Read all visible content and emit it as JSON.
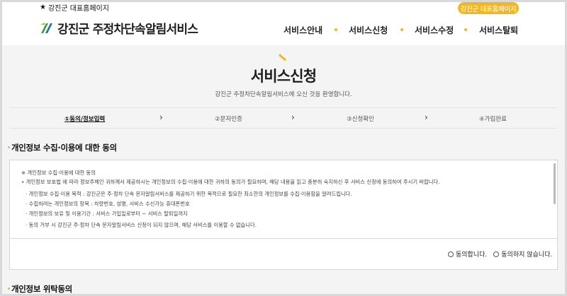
{
  "header": {
    "top_link": "강진군 대표홈페이지",
    "home_button": "강진군 대표홈페이지",
    "logo_text": "강진군 주정차단속알림서비스",
    "nav": [
      "서비스안내",
      "서비스신청",
      "서비스수정",
      "서비스탈퇴"
    ]
  },
  "page": {
    "title": "서비스신청",
    "subtitle": "강진군 주정차단속알림서비스에 오신 것을 환영합니다."
  },
  "steps": [
    "①동의/정보입력",
    "②문자인증",
    "③신청확인",
    "④가입완료"
  ],
  "sections": {
    "consent_title": "개인정보 수집·이용에 대한 동의",
    "entrust_title": "개인정보 위탁동의"
  },
  "terms": {
    "heading": "※ 개인정보 수집·이용에 대한 동의",
    "intro": "• 개인정보 보호법 에 따라 정보주체인 귀하께서 제공하시는 개인정보의 수집·이용에 대한 귀하의 동의가 필요하며, 해당 내용을 읽고 충분히 숙지하신 후 서비스 신청에 동의하여 주시기 바랍니다.",
    "items": [
      "· 개인정보 수집·이용 목적 : 강진군은 주·정차 단속 문자알림서비스를 제공하기 위한 목적으로 필요한 최소한의 개인정보를 수집·이용함을 알려드립니다.",
      "· 수집하려는 개인정보의 항목 : 차량번호, 성명, 서비스 수신가능 휴대폰번호",
      "· 개인정보의 보유 및 이용기간 : 서비스 가입일로부터 ~ 서비스 탈퇴일까지",
      "· 동의 거부 시 강진군 주·정차 단속 문자알림서비스 신청이 되지 않으며, 해당 서비스를 이용할 수 없습니다."
    ]
  },
  "agree": {
    "agree_label": "동의합니다.",
    "disagree_label": "동의하지 않습니다."
  },
  "colors": {
    "accent": "#f4b719",
    "logo_green": "#3b9a3d",
    "logo_blue": "#1f6fb5"
  }
}
